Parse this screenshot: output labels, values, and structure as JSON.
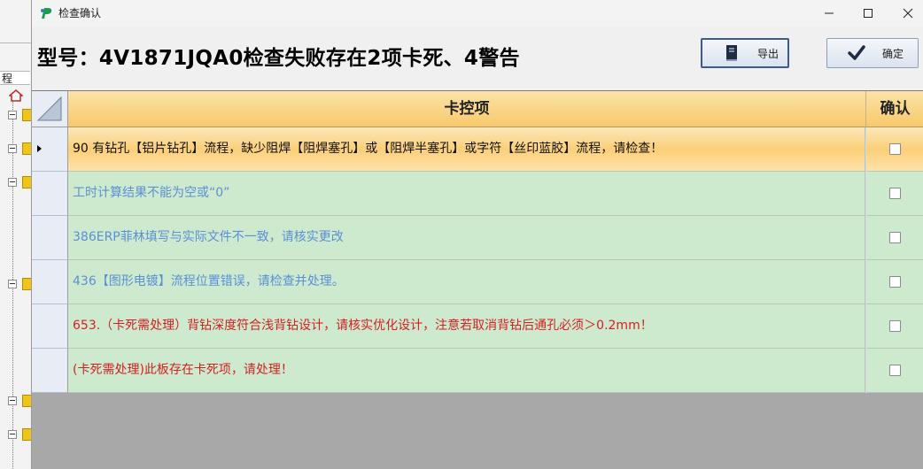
{
  "background_window": {
    "label": "程"
  },
  "window": {
    "title": "检查确认"
  },
  "header": {
    "model_title": "型号：4V1871JQA0检查失败存在2项卡死、4警告",
    "export_label": "导出",
    "confirm_label": "确定"
  },
  "grid": {
    "columns": {
      "item": "卡控项",
      "confirm": "确认"
    },
    "rows": [
      {
        "text": "90 有钻孔【铝片钻孔】流程，缺少阻焊【阻焊塞孔】或【阻焊半塞孔】或字符【丝印蓝胶】流程，请检查！",
        "color": "#111111",
        "selected": true
      },
      {
        "text": "工时计算结果不能为空或“0”",
        "color": "#5b8fd6",
        "selected": false
      },
      {
        "text": "386ERP菲林填写与实际文件不一致，请核实更改",
        "color": "#5b8fd6",
        "selected": false
      },
      {
        "text": "436【图形电镀】流程位置错误，请检查并处理。",
        "color": "#5b8fd6",
        "selected": false
      },
      {
        "text": "653.（卡死需处理）背钻深度符合浅背钻设计，请核实优化设计，注意若取消背钻后通孔必须＞0.2mm！",
        "color": "#d42020",
        "selected": false
      },
      {
        "text": "(卡死需处理)此板存在卡死项，请处理！",
        "color": "#d42020",
        "selected": false
      }
    ]
  },
  "colors": {
    "selected_row": "#fbcf7a",
    "row_bg": "#cdeacf",
    "header_bg": "#f8c96b"
  },
  "icons": {
    "app": "app-logo-icon",
    "export": "book-icon",
    "confirm": "checkmark-icon"
  }
}
